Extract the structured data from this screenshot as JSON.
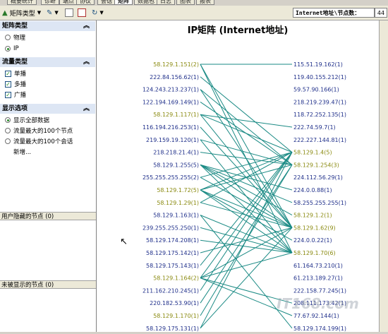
{
  "tabs": [
    "概要统计",
    "诊断",
    "端点",
    "协议",
    "会话",
    "矩阵",
    "数据包",
    "日志",
    "图表",
    "报表"
  ],
  "active_tab": "矩阵",
  "toolbar": {
    "matrix_type_label": "矩阵类型",
    "status_label": "Internet地址\\节点数：",
    "status_count": "44"
  },
  "sidebar": {
    "matrix_type": {
      "title": "矩阵类型",
      "options": [
        {
          "label": "物理",
          "selected": false
        },
        {
          "label": "IP",
          "selected": true
        }
      ]
    },
    "traffic_type": {
      "title": "流量类型",
      "options": [
        {
          "label": "单播",
          "checked": true
        },
        {
          "label": "多播",
          "checked": true
        },
        {
          "label": "广播",
          "checked": true
        }
      ]
    },
    "display_options": {
      "title": "显示选项",
      "options": [
        {
          "label": "显示全部数据",
          "selected": true
        },
        {
          "label": "流量最大的100个节点",
          "selected": false
        },
        {
          "label": "流量最大的100个会话",
          "selected": false
        }
      ],
      "new_label": "新增..."
    },
    "hidden_nodes_title": "用户隐藏的节点 (0)",
    "unshown_nodes_title": "未被显示的节点 (0)"
  },
  "chart": {
    "title": "IP矩阵 (Internet地址)",
    "line_color": "#1a8a84",
    "left_nodes": [
      {
        "label": "58.129.1.151(2)",
        "olive": true
      },
      {
        "label": "222.84.156.62(1)",
        "olive": false
      },
      {
        "label": "124.243.213.237(1)",
        "olive": false
      },
      {
        "label": "122.194.169.149(1)",
        "olive": false
      },
      {
        "label": "58.129.1.117(1)",
        "olive": true
      },
      {
        "label": "116.194.216.253(1)",
        "olive": false
      },
      {
        "label": "219.159.19.120(1)",
        "olive": false
      },
      {
        "label": "218.218.21.4(1)",
        "olive": false
      },
      {
        "label": "58.129.1.255(5)",
        "olive": false
      },
      {
        "label": "255.255.255.255(2)",
        "olive": false
      },
      {
        "label": "58.129.1.72(5)",
        "olive": true
      },
      {
        "label": "58.129.1.29(1)",
        "olive": true
      },
      {
        "label": "58.129.1.163(1)",
        "olive": false
      },
      {
        "label": "239.255.255.250(1)",
        "olive": false
      },
      {
        "label": "58.129.174.208(1)",
        "olive": false
      },
      {
        "label": "58.129.175.142(1)",
        "olive": false
      },
      {
        "label": "58.129.175.143(1)",
        "olive": false
      },
      {
        "label": "58.129.1.164(2)",
        "olive": true
      },
      {
        "label": "211.162.210.245(1)",
        "olive": false
      },
      {
        "label": "220.182.53.90(1)",
        "olive": false
      },
      {
        "label": "58.129.1.170(1)",
        "olive": true
      },
      {
        "label": "58.129.175.131(1)",
        "olive": false
      }
    ],
    "right_nodes": [
      {
        "label": "115.51.19.162(1)",
        "olive": false
      },
      {
        "label": "119.40.155.212(1)",
        "olive": false
      },
      {
        "label": "59.57.90.166(1)",
        "olive": false
      },
      {
        "label": "218.219.239.47(1)",
        "olive": false
      },
      {
        "label": "118.72.252.135(1)",
        "olive": false
      },
      {
        "label": "222.74.59.7(1)",
        "olive": false
      },
      {
        "label": "222.227.144.81(1)",
        "olive": false
      },
      {
        "label": "58.129.1.4(5)",
        "olive": true
      },
      {
        "label": "58.129.1.254(3)",
        "olive": true
      },
      {
        "label": "224.112.56.29(1)",
        "olive": false
      },
      {
        "label": "224.0.0.88(1)",
        "olive": false
      },
      {
        "label": "58.255.255.255(1)",
        "olive": false
      },
      {
        "label": "58.129.1.2(1)",
        "olive": true
      },
      {
        "label": "58.129.1.62(9)",
        "olive": true
      },
      {
        "label": "224.0.0.22(1)",
        "olive": false
      },
      {
        "label": "58.129.1.70(6)",
        "olive": true
      },
      {
        "label": "61.164.73.210(1)",
        "olive": false
      },
      {
        "label": "61.213.189.27(1)",
        "olive": false
      },
      {
        "label": "222.158.77.245(1)",
        "olive": false
      },
      {
        "label": "208.111.173.42(1)",
        "olive": false
      },
      {
        "label": "77.67.92.144(1)",
        "olive": false
      },
      {
        "label": "58.129.174.199(1)",
        "olive": false
      }
    ],
    "links": [
      [
        0,
        0
      ],
      [
        0,
        13
      ],
      [
        0,
        15
      ],
      [
        1,
        7
      ],
      [
        2,
        13
      ],
      [
        3,
        8
      ],
      [
        4,
        13
      ],
      [
        4,
        7
      ],
      [
        4,
        5
      ],
      [
        5,
        13
      ],
      [
        6,
        8
      ],
      [
        7,
        8
      ],
      [
        8,
        11
      ],
      [
        8,
        13
      ],
      [
        8,
        15
      ],
      [
        8,
        12
      ],
      [
        8,
        10
      ],
      [
        9,
        7
      ],
      [
        9,
        13
      ],
      [
        10,
        7
      ],
      [
        10,
        13
      ],
      [
        10,
        15
      ],
      [
        10,
        8
      ],
      [
        10,
        14
      ],
      [
        11,
        7
      ],
      [
        11,
        13
      ],
      [
        12,
        15
      ],
      [
        13,
        15
      ],
      [
        14,
        15
      ],
      [
        15,
        13
      ],
      [
        16,
        7
      ],
      [
        17,
        7
      ],
      [
        17,
        13
      ],
      [
        17,
        15
      ],
      [
        17,
        20
      ],
      [
        17,
        19
      ],
      [
        18,
        7
      ],
      [
        19,
        8
      ],
      [
        20,
        8
      ],
      [
        21,
        7
      ],
      [
        21,
        13
      ],
      [
        12,
        21
      ],
      [
        2,
        8
      ],
      [
        6,
        15
      ]
    ]
  },
  "watermark": "IT168.com"
}
